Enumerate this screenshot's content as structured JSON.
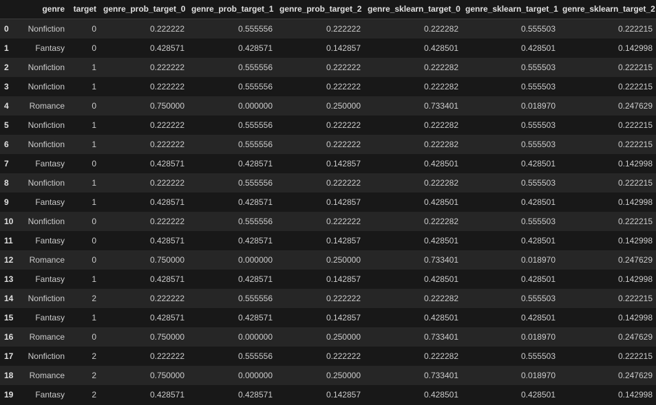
{
  "table": {
    "columns": [
      "",
      "genre",
      "target",
      "genre_prob_target_0",
      "genre_prob_target_1",
      "genre_prob_target_2",
      "genre_sklearn_target_0",
      "genre_sklearn_target_1",
      "genre_sklearn_target_2"
    ],
    "rows": [
      [
        "0",
        "Nonfiction",
        "0",
        "0.222222",
        "0.555556",
        "0.222222",
        "0.222282",
        "0.555503",
        "0.222215"
      ],
      [
        "1",
        "Fantasy",
        "0",
        "0.428571",
        "0.428571",
        "0.142857",
        "0.428501",
        "0.428501",
        "0.142998"
      ],
      [
        "2",
        "Nonfiction",
        "1",
        "0.222222",
        "0.555556",
        "0.222222",
        "0.222282",
        "0.555503",
        "0.222215"
      ],
      [
        "3",
        "Nonfiction",
        "1",
        "0.222222",
        "0.555556",
        "0.222222",
        "0.222282",
        "0.555503",
        "0.222215"
      ],
      [
        "4",
        "Romance",
        "0",
        "0.750000",
        "0.000000",
        "0.250000",
        "0.733401",
        "0.018970",
        "0.247629"
      ],
      [
        "5",
        "Nonfiction",
        "1",
        "0.222222",
        "0.555556",
        "0.222222",
        "0.222282",
        "0.555503",
        "0.222215"
      ],
      [
        "6",
        "Nonfiction",
        "1",
        "0.222222",
        "0.555556",
        "0.222222",
        "0.222282",
        "0.555503",
        "0.222215"
      ],
      [
        "7",
        "Fantasy",
        "0",
        "0.428571",
        "0.428571",
        "0.142857",
        "0.428501",
        "0.428501",
        "0.142998"
      ],
      [
        "8",
        "Nonfiction",
        "1",
        "0.222222",
        "0.555556",
        "0.222222",
        "0.222282",
        "0.555503",
        "0.222215"
      ],
      [
        "9",
        "Fantasy",
        "1",
        "0.428571",
        "0.428571",
        "0.142857",
        "0.428501",
        "0.428501",
        "0.142998"
      ],
      [
        "10",
        "Nonfiction",
        "0",
        "0.222222",
        "0.555556",
        "0.222222",
        "0.222282",
        "0.555503",
        "0.222215"
      ],
      [
        "11",
        "Fantasy",
        "0",
        "0.428571",
        "0.428571",
        "0.142857",
        "0.428501",
        "0.428501",
        "0.142998"
      ],
      [
        "12",
        "Romance",
        "0",
        "0.750000",
        "0.000000",
        "0.250000",
        "0.733401",
        "0.018970",
        "0.247629"
      ],
      [
        "13",
        "Fantasy",
        "1",
        "0.428571",
        "0.428571",
        "0.142857",
        "0.428501",
        "0.428501",
        "0.142998"
      ],
      [
        "14",
        "Nonfiction",
        "2",
        "0.222222",
        "0.555556",
        "0.222222",
        "0.222282",
        "0.555503",
        "0.222215"
      ],
      [
        "15",
        "Fantasy",
        "1",
        "0.428571",
        "0.428571",
        "0.142857",
        "0.428501",
        "0.428501",
        "0.142998"
      ],
      [
        "16",
        "Romance",
        "0",
        "0.750000",
        "0.000000",
        "0.250000",
        "0.733401",
        "0.018970",
        "0.247629"
      ],
      [
        "17",
        "Nonfiction",
        "2",
        "0.222222",
        "0.555556",
        "0.222222",
        "0.222282",
        "0.555503",
        "0.222215"
      ],
      [
        "18",
        "Romance",
        "2",
        "0.750000",
        "0.000000",
        "0.250000",
        "0.733401",
        "0.018970",
        "0.247629"
      ],
      [
        "19",
        "Fantasy",
        "2",
        "0.428571",
        "0.428571",
        "0.142857",
        "0.428501",
        "0.428501",
        "0.142998"
      ]
    ]
  }
}
